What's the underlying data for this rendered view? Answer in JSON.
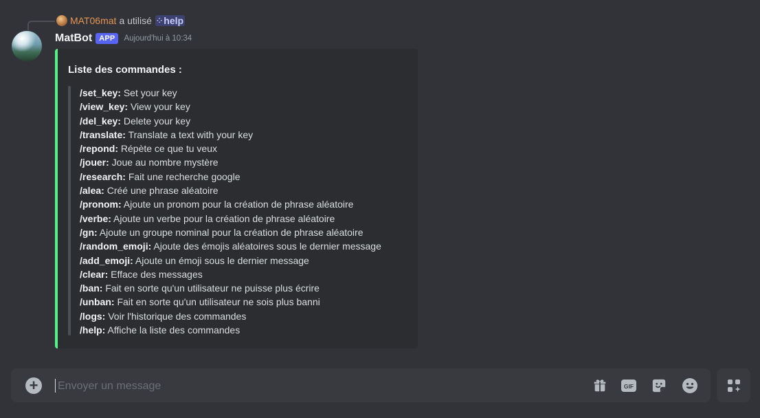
{
  "reply": {
    "username": "MAT06mat",
    "action_text": "a utilisé",
    "command": "help"
  },
  "message": {
    "author": "MatBot",
    "tag": "APP",
    "timestamp": "Aujourd'hui à 10:34"
  },
  "embed": {
    "accent_color": "#57f287",
    "title": "Liste des commandes :",
    "commands": [
      {
        "name": "/set_key:",
        "desc": "Set your key"
      },
      {
        "name": "/view_key:",
        "desc": "View your key"
      },
      {
        "name": "/del_key:",
        "desc": "Delete your key"
      },
      {
        "name": "/translate:",
        "desc": "Translate a text with your key"
      },
      {
        "name": "/repond:",
        "desc": "Répète ce que tu veux"
      },
      {
        "name": "/jouer:",
        "desc": "Joue au nombre mystère"
      },
      {
        "name": "/research:",
        "desc": "Fait une recherche google"
      },
      {
        "name": "/alea:",
        "desc": "Créé une phrase aléatoire"
      },
      {
        "name": "/pronom:",
        "desc": "Ajoute un pronom pour la création de phrase aléatoire"
      },
      {
        "name": "/verbe:",
        "desc": "Ajoute un verbe pour la création de phrase aléatoire"
      },
      {
        "name": "/gn:",
        "desc": "Ajoute un groupe nominal pour la création de phrase aléatoire"
      },
      {
        "name": "/random_emoji:",
        "desc": "Ajoute des émojis aléatoires sous le dernier message"
      },
      {
        "name": "/add_emoji:",
        "desc": "Ajoute un émoji sous le dernier message"
      },
      {
        "name": "/clear:",
        "desc": "Efface des messages"
      },
      {
        "name": "/ban:",
        "desc": "Fait en sorte qu'un utilisateur ne puisse plus écrire"
      },
      {
        "name": "/unban:",
        "desc": "Fait en sorte qu'un utilisateur ne sois plus banni"
      },
      {
        "name": "/logs:",
        "desc": "Voir l'historique des commandes"
      },
      {
        "name": "/help:",
        "desc": "Affiche la liste des commandes"
      }
    ]
  },
  "composer": {
    "placeholder": "Envoyer un message",
    "tools": [
      {
        "icon": "gift-icon"
      },
      {
        "icon": "gif-icon",
        "label": "GIF"
      },
      {
        "icon": "sticker-icon"
      },
      {
        "icon": "emoji-icon"
      }
    ],
    "apps_icon": "apps-icon"
  },
  "colors": {
    "background": "#313338",
    "embed_background": "#2b2d31",
    "app_tag": "#5865f2",
    "reply_username": "#e59552"
  }
}
